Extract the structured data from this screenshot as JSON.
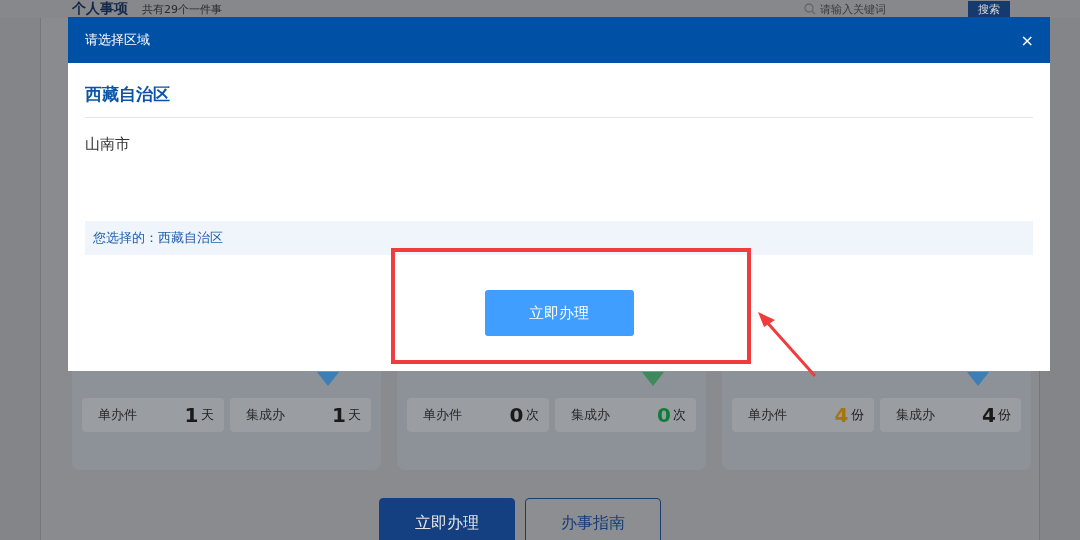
{
  "page": {
    "title": "个人事项",
    "count_text": "共有29个一件事",
    "search": {
      "placeholder": "请输入关键词"
    },
    "search_button": "搜索"
  },
  "cards": [
    {
      "color": "#3b7fb5",
      "stats": [
        {
          "label": "单办件",
          "value": "1",
          "unit": "天",
          "color": "#1a1a1a"
        },
        {
          "label": "集成办",
          "value": "1",
          "unit": "天",
          "color": "#1a1a1a"
        }
      ]
    },
    {
      "color": "#3f8a5c",
      "stats": [
        {
          "label": "单办件",
          "value": "0",
          "unit": "次",
          "color": "#1a1a1a"
        },
        {
          "label": "集成办",
          "value": "0",
          "unit": "次",
          "color": "#0f7d38"
        }
      ]
    },
    {
      "color": "#3b7fb5",
      "stats": [
        {
          "label": "单办件",
          "value": "4",
          "unit": "份",
          "color": "#a8740e"
        },
        {
          "label": "集成办",
          "value": "4",
          "unit": "份",
          "color": "#1a1a1a"
        }
      ]
    }
  ],
  "actions": [
    {
      "label": "立即办理",
      "kind": "primary"
    },
    {
      "label": "办事指南",
      "kind": "outline"
    }
  ],
  "dialog": {
    "title": "请选择区域",
    "close": "×",
    "region": "西藏自治区",
    "cities": [
      {
        "name": "山南市"
      }
    ],
    "selection_text": "您选择的：西藏自治区",
    "button": "立即办理"
  }
}
